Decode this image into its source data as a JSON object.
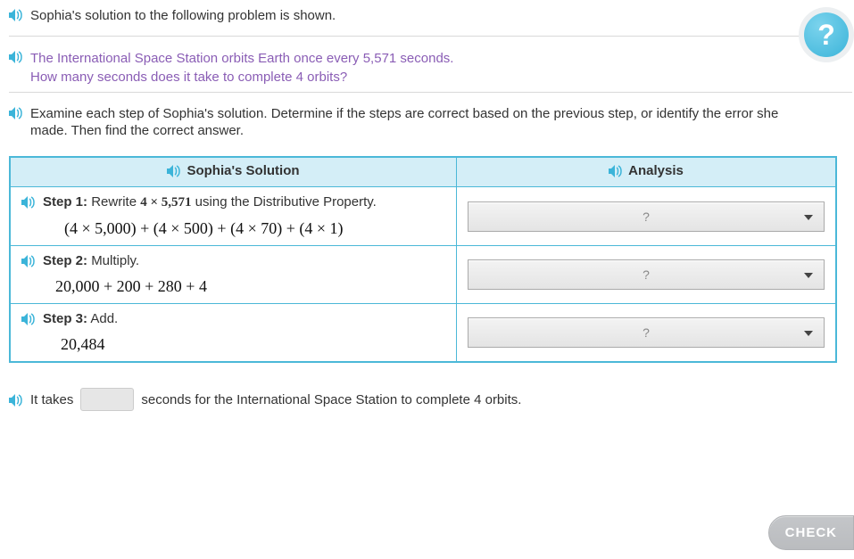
{
  "intro": "Sophia's solution to the following problem is shown.",
  "problem": {
    "line1": "The International Space Station orbits Earth once every 5,571 seconds.",
    "line2": "How many seconds does it take to complete 4 orbits?"
  },
  "instruction": "Examine each step of Sophia's solution. Determine if the steps are correct based on the previous step, or identify the error she made. Then find the correct answer.",
  "headers": {
    "solution": "Sophia's Solution",
    "analysis": "Analysis"
  },
  "steps": [
    {
      "label": "Step 1:",
      "desc_prefix": "Rewrite ",
      "desc_math": "4 × 5,571",
      "desc_suffix": " using the Distributive Property.",
      "math": "(4 × 5,000) + (4 × 500) + (4 × 70) + (4 × 1)"
    },
    {
      "label": "Step 2:",
      "desc_prefix": "Multiply.",
      "desc_math": "",
      "desc_suffix": "",
      "math": "20,000 + 200 + 280 + 4"
    },
    {
      "label": "Step 3:",
      "desc_prefix": "Add.",
      "desc_math": "",
      "desc_suffix": "",
      "math": "20,484"
    }
  ],
  "dropdown_placeholder": "?",
  "answer": {
    "prefix": "It takes",
    "suffix": "seconds for the International Space Station to complete 4 orbits."
  },
  "help": "?",
  "check": "CHECK"
}
